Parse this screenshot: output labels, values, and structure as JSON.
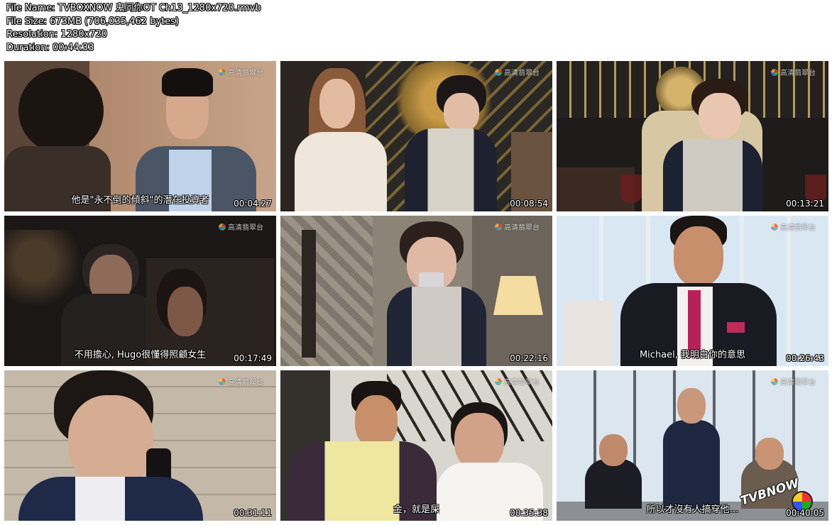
{
  "header": {
    "file_name": "File Name: TVBOXNOW 鬼同你OT Ch13_1280x720.rmvb",
    "file_size": "File Size: 673MB (706,035,462 bytes)",
    "resolution": "Resolution: 1280x720",
    "duration": "Duration: 00:44:33"
  },
  "channel_bug": "高清翡翠台",
  "thumbnails": [
    {
      "timestamp": "00:04:27",
      "subtitle": "他是\"永不倒的傾斜\"的潛在投資者"
    },
    {
      "timestamp": "00:08:54",
      "subtitle": ""
    },
    {
      "timestamp": "00:13:21",
      "subtitle": ""
    },
    {
      "timestamp": "00:17:49",
      "subtitle": "不用擔心, Hugo很懂得照顧女生"
    },
    {
      "timestamp": "00:22:16",
      "subtitle": ""
    },
    {
      "timestamp": "00:26:43",
      "subtitle": "Michael, 我明白你的意思"
    },
    {
      "timestamp": "00:31:11",
      "subtitle": ""
    },
    {
      "timestamp": "00:35:38",
      "subtitle": "金，就是屎"
    },
    {
      "timestamp": "00:40:05",
      "subtitle": "所以才沒有人搞穿他…"
    }
  ],
  "watermark": "TVBNOW",
  "colors": {
    "header_text": "#ffffff",
    "background": "#ffffff"
  }
}
